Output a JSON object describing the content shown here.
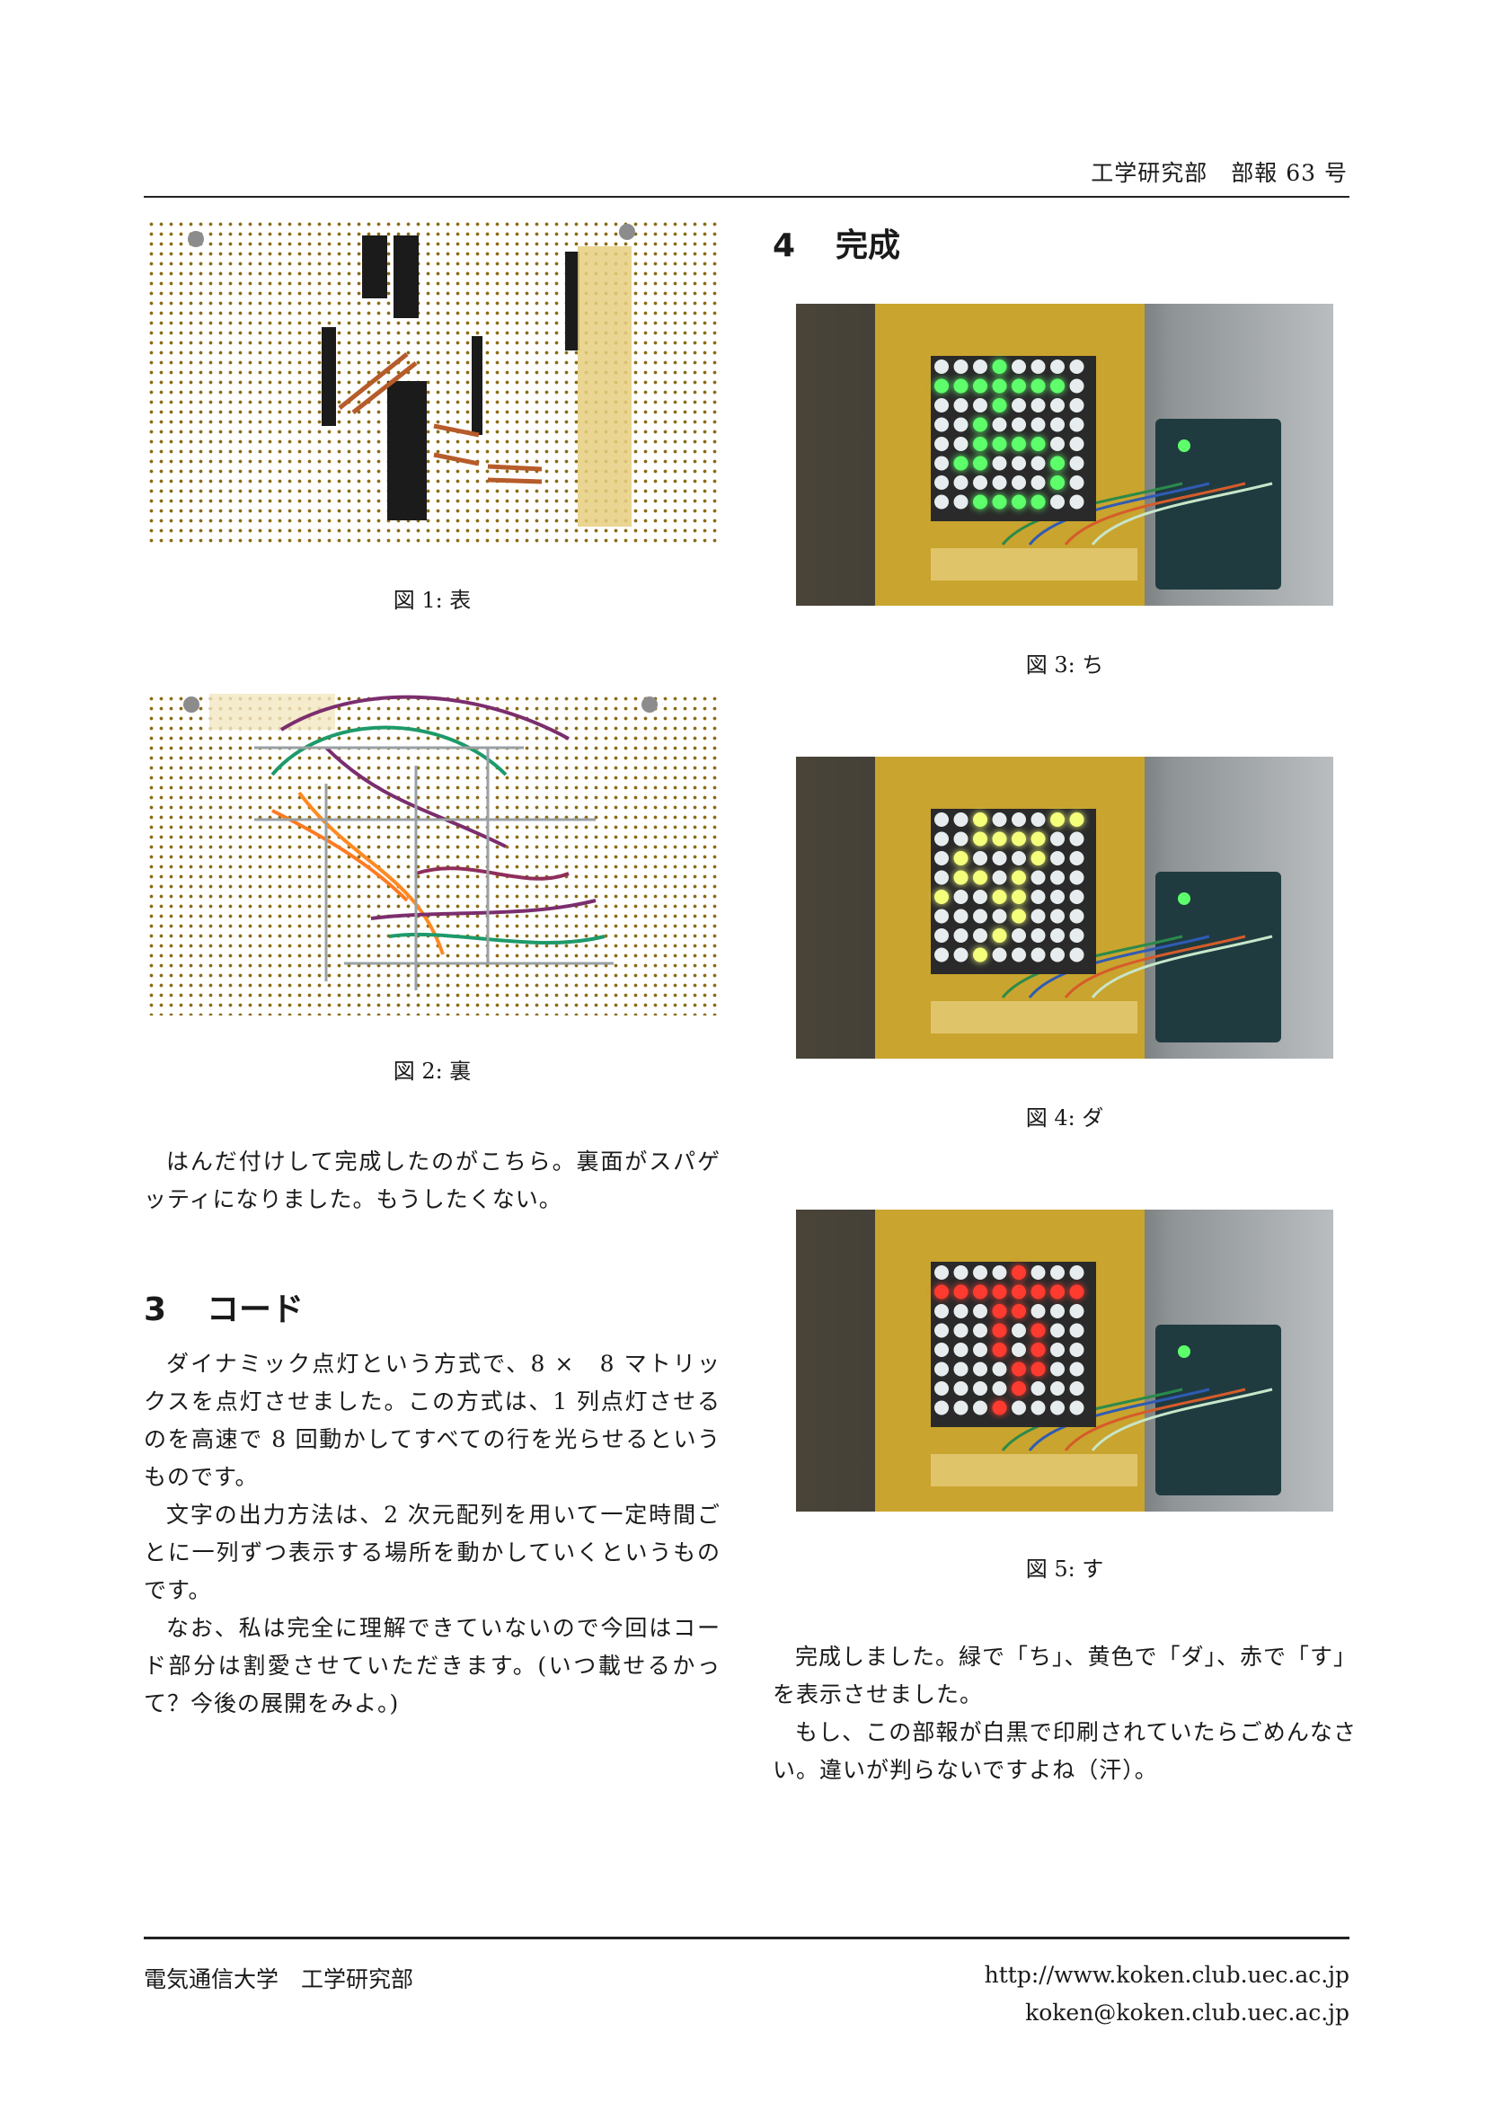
{
  "header": {
    "text": "工学研究部　部報 63 号"
  },
  "figures": {
    "fig1": {
      "caption": "図 1: 表"
    },
    "fig2": {
      "caption": "図 2: 裏"
    },
    "fig3": {
      "caption": "図 3: ち"
    },
    "fig4": {
      "caption": "図 4: ダ"
    },
    "fig5": {
      "caption": "図 5: す"
    }
  },
  "left": {
    "intro": [
      "はんだ付けして完成したのがこちら。裏面がスパゲッティになりました。もうしたくない。"
    ],
    "section3": {
      "num": "3",
      "title": "コード"
    },
    "section3_paras": [
      "ダイナミック点灯という方式で、8 ×　8 マトリックスを点灯させました。この方式は、1 列点灯させるのを高速で 8 回動かしてすべての行を光らせるというものです。",
      "文字の出力方法は、2 次元配列を用いて一定時間ごとに一列ずつ表示する場所を動かしていくというものです。",
      "なお、私は完全に理解できていないので今回はコード部分は割愛させていただきます。(いつ載せるかって？今後の展開をみよ。)"
    ]
  },
  "right": {
    "section4": {
      "num": "4",
      "title": "完成"
    },
    "paras": [
      "完成しました。緑で「ち」、黄色で「ダ」、赤で「す」を表示させました。",
      "もし、この部報が白黒で印刷されていたらごめんなさい。違いが判らないですよね（汗）。"
    ]
  },
  "led": {
    "colors": {
      "green": "#5dff6a",
      "yellow": "#f4ff7a",
      "red": "#ff3b30",
      "off": "#e7ecee"
    },
    "ti": [
      [
        0,
        0,
        0,
        1,
        0,
        0,
        0,
        0
      ],
      [
        1,
        1,
        1,
        1,
        1,
        1,
        1,
        0
      ],
      [
        0,
        0,
        0,
        1,
        0,
        0,
        0,
        0
      ],
      [
        0,
        0,
        1,
        0,
        0,
        0,
        0,
        0
      ],
      [
        0,
        0,
        1,
        1,
        1,
        1,
        0,
        0
      ],
      [
        0,
        1,
        1,
        0,
        0,
        0,
        1,
        0
      ],
      [
        0,
        0,
        0,
        0,
        0,
        0,
        1,
        0
      ],
      [
        0,
        0,
        1,
        1,
        1,
        1,
        0,
        0
      ]
    ],
    "da": [
      [
        0,
        0,
        1,
        0,
        0,
        0,
        1,
        1
      ],
      [
        0,
        0,
        1,
        1,
        1,
        1,
        0,
        0
      ],
      [
        0,
        1,
        0,
        0,
        0,
        1,
        0,
        0
      ],
      [
        0,
        1,
        1,
        0,
        1,
        0,
        0,
        0
      ],
      [
        1,
        0,
        0,
        1,
        1,
        0,
        0,
        0
      ],
      [
        0,
        0,
        0,
        0,
        1,
        0,
        0,
        0
      ],
      [
        0,
        0,
        0,
        1,
        0,
        0,
        0,
        0
      ],
      [
        0,
        0,
        1,
        0,
        0,
        0,
        0,
        0
      ]
    ],
    "su": [
      [
        0,
        0,
        0,
        0,
        1,
        0,
        0,
        0
      ],
      [
        1,
        1,
        1,
        1,
        1,
        1,
        1,
        1
      ],
      [
        0,
        0,
        0,
        1,
        1,
        0,
        0,
        0
      ],
      [
        0,
        0,
        0,
        1,
        0,
        1,
        0,
        0
      ],
      [
        0,
        0,
        0,
        1,
        0,
        1,
        0,
        0
      ],
      [
        0,
        0,
        0,
        0,
        1,
        1,
        0,
        0
      ],
      [
        0,
        0,
        0,
        0,
        1,
        0,
        0,
        0
      ],
      [
        0,
        0,
        0,
        1,
        0,
        0,
        0,
        0
      ]
    ]
  },
  "footer": {
    "left": "電気通信大学　工学研究部",
    "url": "http://www.koken.club.uec.ac.jp",
    "email": "koken@koken.club.uec.ac.jp"
  }
}
